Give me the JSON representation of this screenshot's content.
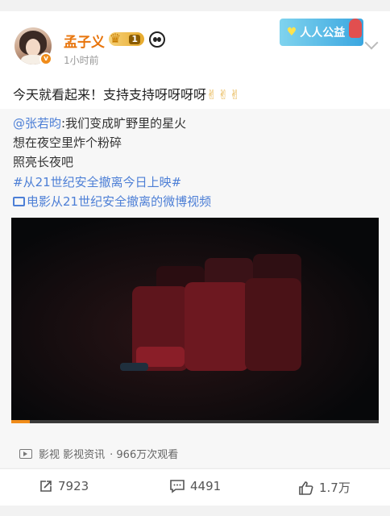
{
  "post": {
    "author": "孟子义",
    "vip_level": "1",
    "time": "1小时前",
    "charity_badge": "人人公益",
    "text": "今天就看起来！支持支持呀呀呀呀",
    "text_emoji": "✌✌✌"
  },
  "quoted": {
    "mention": "@张若昀",
    "line1_rest": ":我们变成旷野里的星火",
    "line2": "想在夜空里炸个粉碎",
    "line3": "照亮长夜吧",
    "hashtag": "#从21世纪安全撤离今日上映#",
    "video_link": "电影从21世纪安全撤离的微博视频",
    "video_progress": 0.05,
    "video_source": "影视 影视资讯",
    "video_views": "· 966万次观看"
  },
  "actions": {
    "repost_count": "7923",
    "comment_count": "4491",
    "like_count": "1.7万"
  },
  "colors": {
    "author": "#e8750c",
    "link": "#4d7fd6",
    "background": "#f2f2f2"
  },
  "icons": [
    "verified-icon",
    "vip-crown-icon",
    "panda-icon",
    "chevron-down-icon",
    "video-play-icon",
    "tv-icon",
    "repost-icon",
    "comment-icon",
    "like-icon"
  ]
}
